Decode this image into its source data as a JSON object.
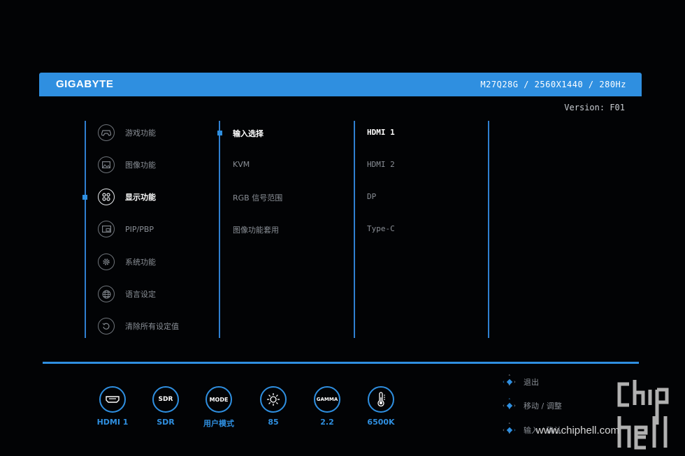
{
  "header": {
    "brand": "GIGABYTE",
    "model_info": "M27Q28G / 2560X1440 / 280Hz",
    "accent": "#2f8fe0"
  },
  "version": "Version: F01",
  "main_menu": [
    {
      "label": "游戏功能",
      "icon": "gamepad-icon",
      "active": false
    },
    {
      "label": "图像功能",
      "icon": "picture-icon",
      "active": false
    },
    {
      "label": "显示功能",
      "icon": "display-grid-icon",
      "active": true
    },
    {
      "label": "PIP/PBP",
      "icon": "pip-icon",
      "active": false
    },
    {
      "label": "系统功能",
      "icon": "gear-icon",
      "active": false
    },
    {
      "label": "语言设定",
      "icon": "globe-icon",
      "active": false
    },
    {
      "label": "清除所有设定值",
      "icon": "reset-icon",
      "active": false
    }
  ],
  "sub_menu": [
    {
      "label": "输入选择",
      "active": true
    },
    {
      "label": "KVM",
      "active": false
    },
    {
      "label": "RGB 信号范围",
      "active": false
    },
    {
      "label": "图像功能套用",
      "active": false
    }
  ],
  "options": [
    {
      "label": "HDMI 1",
      "active": true
    },
    {
      "label": "HDMI 2",
      "active": false
    },
    {
      "label": "DP",
      "active": false
    },
    {
      "label": "Type-C",
      "active": false
    }
  ],
  "status": [
    {
      "icon_text": "",
      "icon": "hdmi-port-icon",
      "value": "HDMI 1"
    },
    {
      "icon_text": "SDR",
      "icon": "sdr-icon",
      "value": "SDR"
    },
    {
      "icon_text": "MODE",
      "icon": "mode-icon",
      "value": "用户模式"
    },
    {
      "icon_text": "",
      "icon": "brightness-icon",
      "value": "85"
    },
    {
      "icon_text": "GAMMA",
      "icon": "gamma-icon",
      "value": "2.2"
    },
    {
      "icon_text": "",
      "icon": "thermometer-icon",
      "value": "6500K"
    }
  ],
  "help": [
    {
      "label": "退出",
      "icon": "joystick-left-icon"
    },
    {
      "label": "移动 / 调整",
      "icon": "joystick-updown-icon"
    },
    {
      "label": "输入 / 确认",
      "icon": "joystick-press-icon"
    }
  ],
  "watermark": "www.chiphell.com"
}
